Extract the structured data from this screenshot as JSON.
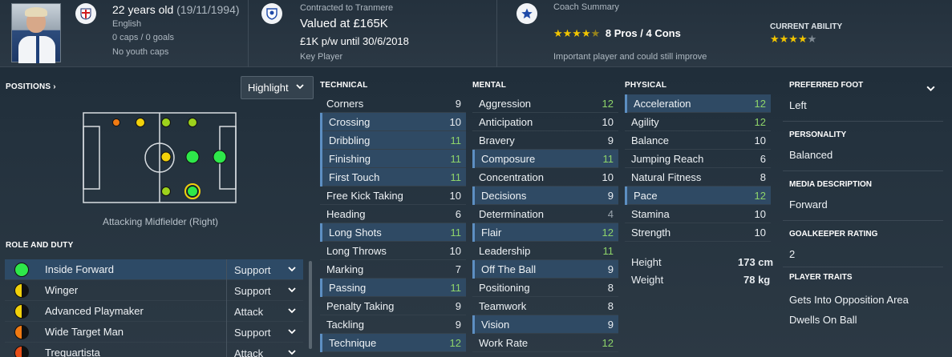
{
  "header": {
    "age": "22 years old",
    "dob": "(19/11/1994)",
    "nationality": "English",
    "caps": "0 caps / 0 goals",
    "youth_caps": "No youth caps",
    "contract_label": "Contracted to Tranmere",
    "value": "Valued at £165K",
    "wage": "£1K p/w until 30/6/2018",
    "squad_status": "Key Player",
    "coach_label": "Coach Summary",
    "pros_cons": "8 Pros / 4 Cons",
    "coach_stars": 4.0,
    "coach_note": "Important player and could still improve",
    "current_ability_label": "CURRENT ABILITY",
    "current_ability_stars": 4.0
  },
  "positions": {
    "title": "POSITIONS",
    "highlight_label": "Highlight",
    "caption": "Attacking Midfielder (Right)"
  },
  "roles": {
    "title": "ROLE AND DUTY",
    "items": [
      {
        "name": "Inside Forward",
        "duty": "Support"
      },
      {
        "name": "Winger",
        "duty": "Support"
      },
      {
        "name": "Advanced Playmaker",
        "duty": "Attack"
      },
      {
        "name": "Wide Target Man",
        "duty": "Support"
      },
      {
        "name": "Trequartista",
        "duty": "Attack"
      }
    ]
  },
  "technical": {
    "title": "TECHNICAL",
    "items": [
      {
        "name": "Corners",
        "value": "9"
      },
      {
        "name": "Crossing",
        "value": "10"
      },
      {
        "name": "Dribbling",
        "value": "11"
      },
      {
        "name": "Finishing",
        "value": "11"
      },
      {
        "name": "First Touch",
        "value": "11"
      },
      {
        "name": "Free Kick Taking",
        "value": "10"
      },
      {
        "name": "Heading",
        "value": "6"
      },
      {
        "name": "Long Shots",
        "value": "11"
      },
      {
        "name": "Long Throws",
        "value": "10"
      },
      {
        "name": "Marking",
        "value": "7"
      },
      {
        "name": "Passing",
        "value": "11"
      },
      {
        "name": "Penalty Taking",
        "value": "9"
      },
      {
        "name": "Tackling",
        "value": "9"
      },
      {
        "name": "Technique",
        "value": "12"
      }
    ]
  },
  "mental": {
    "title": "MENTAL",
    "items": [
      {
        "name": "Aggression",
        "value": "12"
      },
      {
        "name": "Anticipation",
        "value": "10"
      },
      {
        "name": "Bravery",
        "value": "9"
      },
      {
        "name": "Composure",
        "value": "11"
      },
      {
        "name": "Concentration",
        "value": "10"
      },
      {
        "name": "Decisions",
        "value": "9"
      },
      {
        "name": "Determination",
        "value": "4"
      },
      {
        "name": "Flair",
        "value": "12"
      },
      {
        "name": "Leadership",
        "value": "11"
      },
      {
        "name": "Off The Ball",
        "value": "9"
      },
      {
        "name": "Positioning",
        "value": "8"
      },
      {
        "name": "Teamwork",
        "value": "8"
      },
      {
        "name": "Vision",
        "value": "9"
      },
      {
        "name": "Work Rate",
        "value": "12"
      }
    ]
  },
  "physical": {
    "title": "PHYSICAL",
    "items": [
      {
        "name": "Acceleration",
        "value": "12"
      },
      {
        "name": "Agility",
        "value": "12"
      },
      {
        "name": "Balance",
        "value": "10"
      },
      {
        "name": "Jumping Reach",
        "value": "6"
      },
      {
        "name": "Natural Fitness",
        "value": "8"
      },
      {
        "name": "Pace",
        "value": "12"
      },
      {
        "name": "Stamina",
        "value": "10"
      },
      {
        "name": "Strength",
        "value": "10"
      }
    ],
    "height_label": "Height",
    "height": "173 cm",
    "weight_label": "Weight",
    "weight": "78 kg"
  },
  "info": {
    "preferred_foot_label": "PREFERRED FOOT",
    "preferred_foot": "Left",
    "personality_label": "PERSONALITY",
    "personality": "Balanced",
    "media_label": "MEDIA DESCRIPTION",
    "media": "Forward",
    "gk_label": "GOALKEEPER RATING",
    "gk": "2",
    "traits_label": "PLAYER TRAITS",
    "traits": [
      "Gets Into Opposition Area",
      "Dwells On Ball"
    ]
  },
  "colors": {
    "green": "#2ee84a",
    "yellow_green": "#9dd21c",
    "yellow": "#f2d10a",
    "orange": "#f07a12",
    "highlight_row": "#2f4a64",
    "good_value": "#8ed46a"
  }
}
